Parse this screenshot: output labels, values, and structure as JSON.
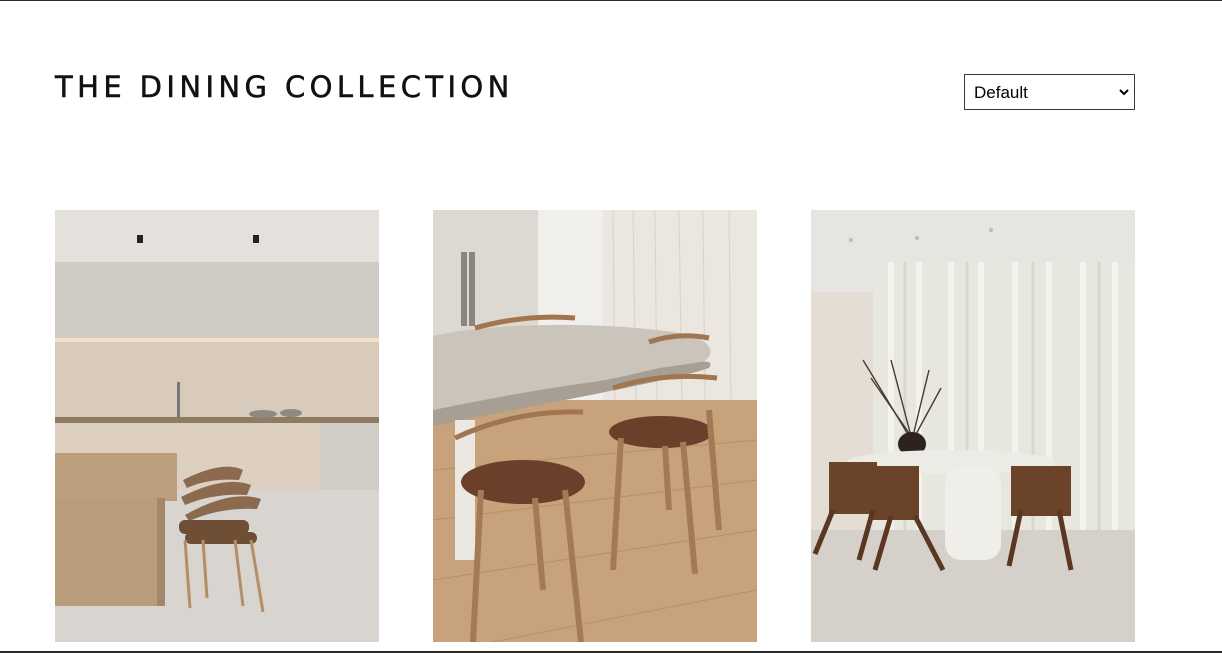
{
  "page": {
    "title": "THE DINING COLLECTION"
  },
  "sort": {
    "selected": "Default",
    "icon": "chevron-down-icon"
  },
  "products": [
    {
      "image": "kitchen-island-dining-photo"
    },
    {
      "image": "curved-table-chairs-photo"
    },
    {
      "image": "oval-table-curtains-photo"
    }
  ]
}
